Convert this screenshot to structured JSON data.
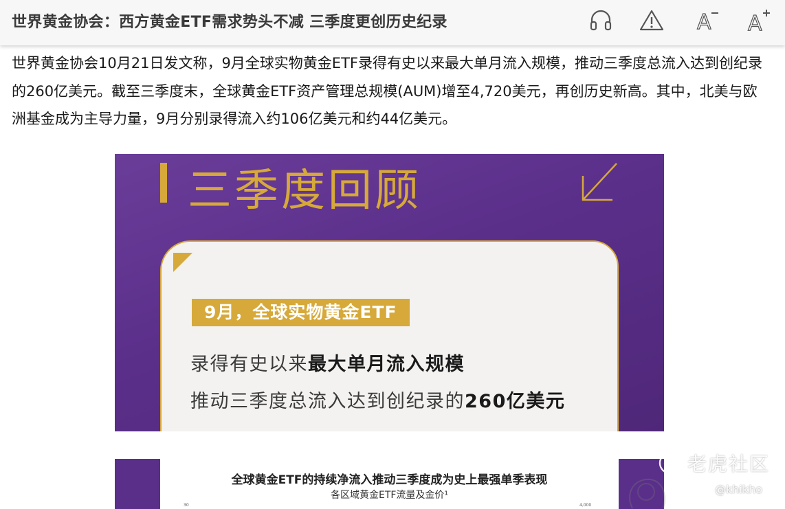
{
  "header": {
    "title": "世界黄金协会：西方黄金ETF需求势头不减 三季度更创历史纪录",
    "icons": [
      "headphones-icon",
      "warning-icon",
      "font-decrease-icon",
      "font-increase-icon"
    ],
    "font_decrease_symbol": "A",
    "font_increase_symbol": "A"
  },
  "article": {
    "paragraph": "世界黄金协会10月21日发文称，9月全球实物黄金ETF录得有史以来最大单月流入规模，推动三季度总流入达到创纪录的260亿美元。截至三季度末，全球黄金ETF资产管理总规模(AUM)增至4,720美元，再创历史新高。其中，北美与欧洲基金成为主导力量，9月分别录得流入约106亿美元和约44亿美元。"
  },
  "banner": {
    "heading": "三季度回顾",
    "tag": "9月，全球实物黄金ETF",
    "line1_plain": "录得有史以来",
    "line1_bold": "最大单月流入规模",
    "line2_plain": "推动三季度总流入达到创纪录的",
    "line2_bold": "260亿美元",
    "accent_color": "#d6a93a",
    "background_color": "#5a2f8a"
  },
  "chart_panel": {
    "title": "全球黄金ETF的持续净流入推动三季度成为史上最强单季表现",
    "subtitle": "各区域黄金ETF流量及金价¹",
    "axis_left_label": "30",
    "axis_right_label": "4,000"
  },
  "watermark": {
    "brand": "老虎社区",
    "user": "@khikho"
  }
}
